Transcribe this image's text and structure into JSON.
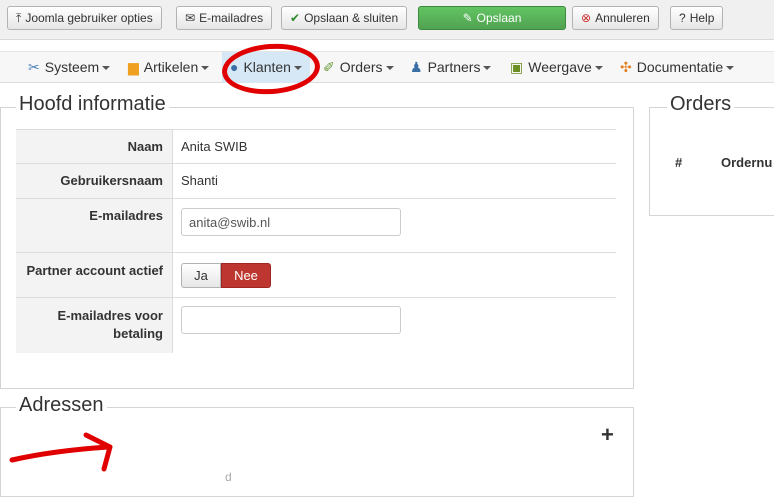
{
  "toolbar": {
    "joomla_user": "Joomla gebruiker opties",
    "email": "E-mailadres",
    "save_close": "Opslaan & sluiten",
    "save": "Opslaan",
    "cancel": "Annuleren",
    "help": "Help"
  },
  "menu": {
    "items": [
      {
        "label": "Systeem"
      },
      {
        "label": "Artikelen"
      },
      {
        "label": "Klanten"
      },
      {
        "label": "Orders"
      },
      {
        "label": "Partners"
      },
      {
        "label": "Weergave"
      },
      {
        "label": "Documentatie"
      }
    ]
  },
  "main": {
    "legend": "Hoofd informatie",
    "fields": {
      "name_label": "Naam",
      "name_value": "Anita SWIB",
      "username_label": "Gebruikersnaam",
      "username_value": "Shanti",
      "email_label": "E-mailadres",
      "email_value": "anita@swib.nl",
      "partner_label": "Partner account actief",
      "partner_yes": "Ja",
      "partner_no": "Nee",
      "payment_email_label_1": "E-mailadres voor",
      "payment_email_label_2": "betaling",
      "payment_email_value": ""
    }
  },
  "orders": {
    "legend": "Orders",
    "col_hash": "#",
    "col_ordernumber": "Ordernu"
  },
  "addresses": {
    "legend": "Adressen",
    "add_symbol": "+",
    "partial_text": "d"
  },
  "colors": {
    "save_green": "#51a351",
    "toggle_active_red": "#bd362f",
    "menu_active": "#d6e8f6",
    "annotation_red": "#e00000"
  }
}
